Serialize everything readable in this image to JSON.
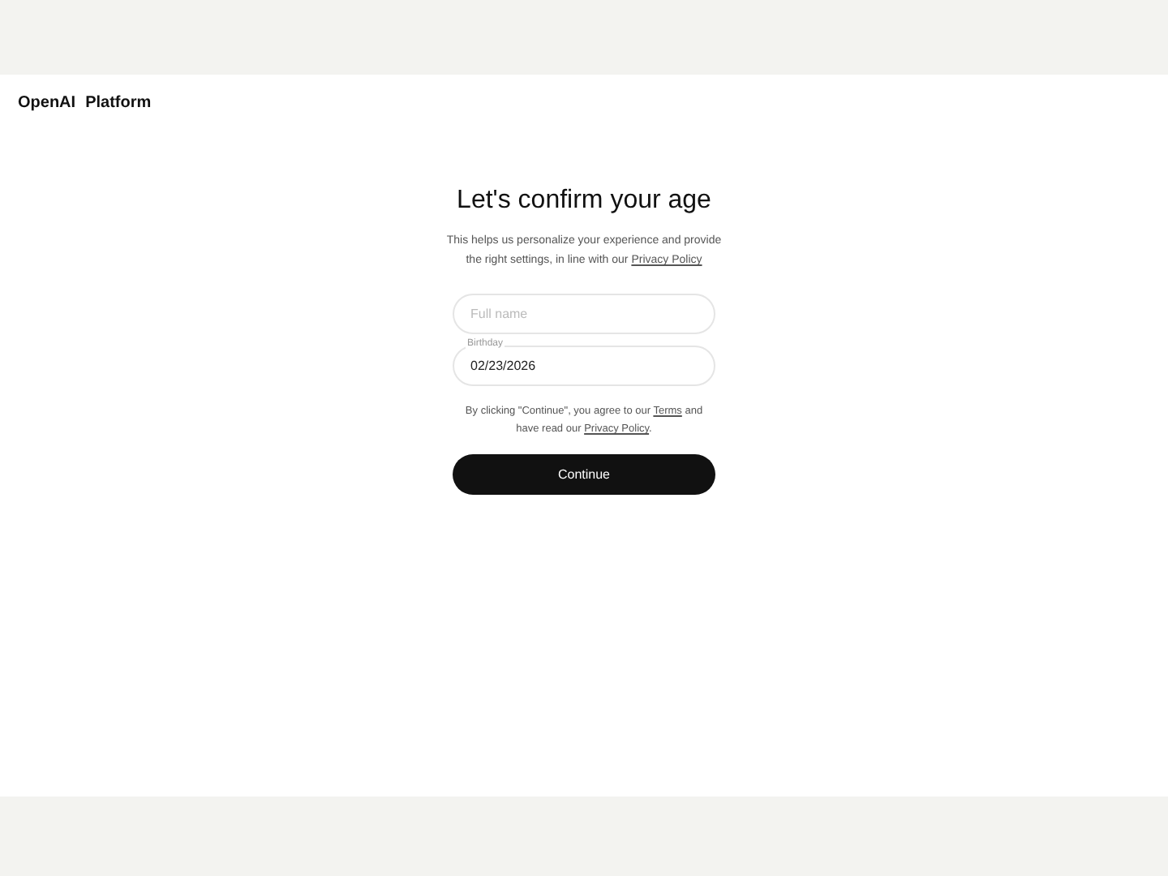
{
  "header": {
    "brand": "OpenAI",
    "product": "Platform"
  },
  "title": "Let's confirm your age",
  "intro": {
    "before": "This helps us personalize your experience and provide the right settings, in line with our ",
    "link": "Privacy Policy"
  },
  "full_name": {
    "placeholder": "Full name"
  },
  "birthday": {
    "label": "Birthday",
    "value": "02/23/2026"
  },
  "consent": {
    "before": "By clicking \"Continue\", you agree to our ",
    "link1": "Terms",
    "middle": " and have read our ",
    "link2": "Privacy Policy",
    "after": "."
  },
  "continue_button": "Continue"
}
